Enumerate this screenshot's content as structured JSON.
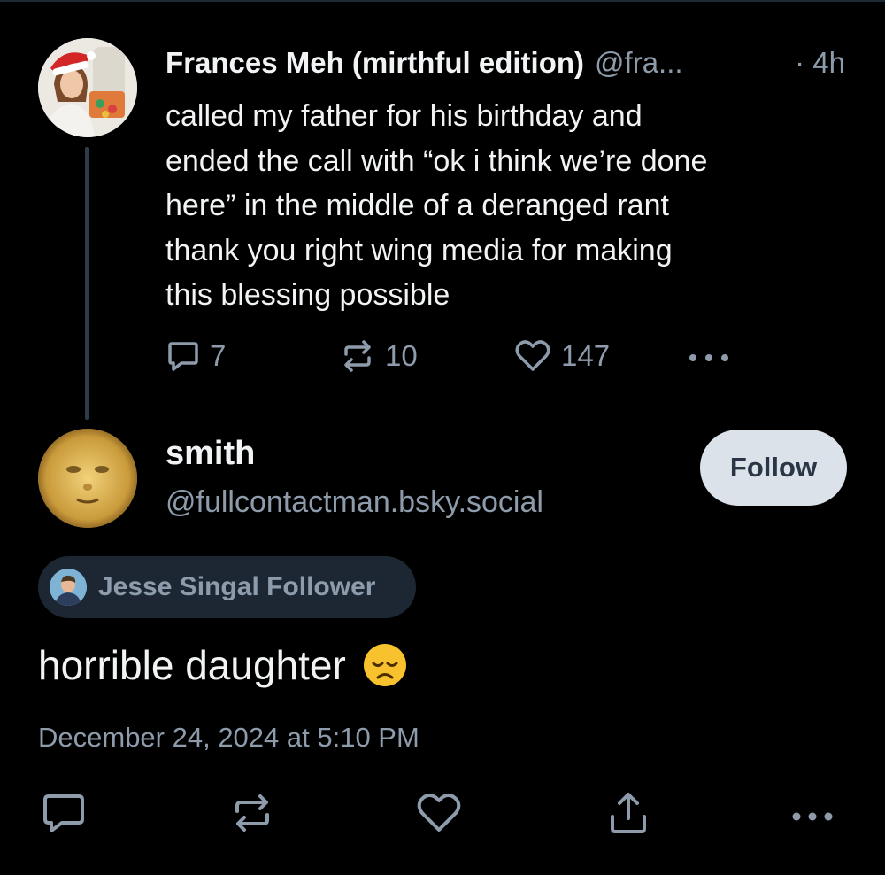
{
  "parent_post": {
    "author_name": "Frances Meh (mirthful edition)",
    "author_handle": "@fra...",
    "time": "· 4h",
    "text_lines": [
      "called my father for his birthday and",
      "ended the call with “ok i think we’re done",
      "here” in the middle of a deranged rant",
      "thank you right wing media for making",
      "this blessing possible"
    ],
    "reply_count": "7",
    "repost_count": "10",
    "like_count": "147"
  },
  "reply_post": {
    "author_name": "smith",
    "author_handle": "@fullcontactman.bsky.social",
    "follow_label": "Follow",
    "badge_label": "Jesse Singal Follower",
    "text": "horrible daughter",
    "emoji": "disappointed-face",
    "timestamp": "December 24, 2024 at 5:10 PM"
  },
  "icons": {
    "reply": "comment-bubble-icon",
    "repost": "repost-arrows-icon",
    "like": "heart-icon",
    "share": "share-upload-icon",
    "more": "more-dots-icon"
  },
  "colors": {
    "background": "#000000",
    "primary_text": "#f1f3f5",
    "secondary_text": "#8d9bab",
    "follow_button_bg": "#dbe2ea",
    "badge_bg": "#1c2733",
    "thread_line": "#2e3b4c"
  }
}
